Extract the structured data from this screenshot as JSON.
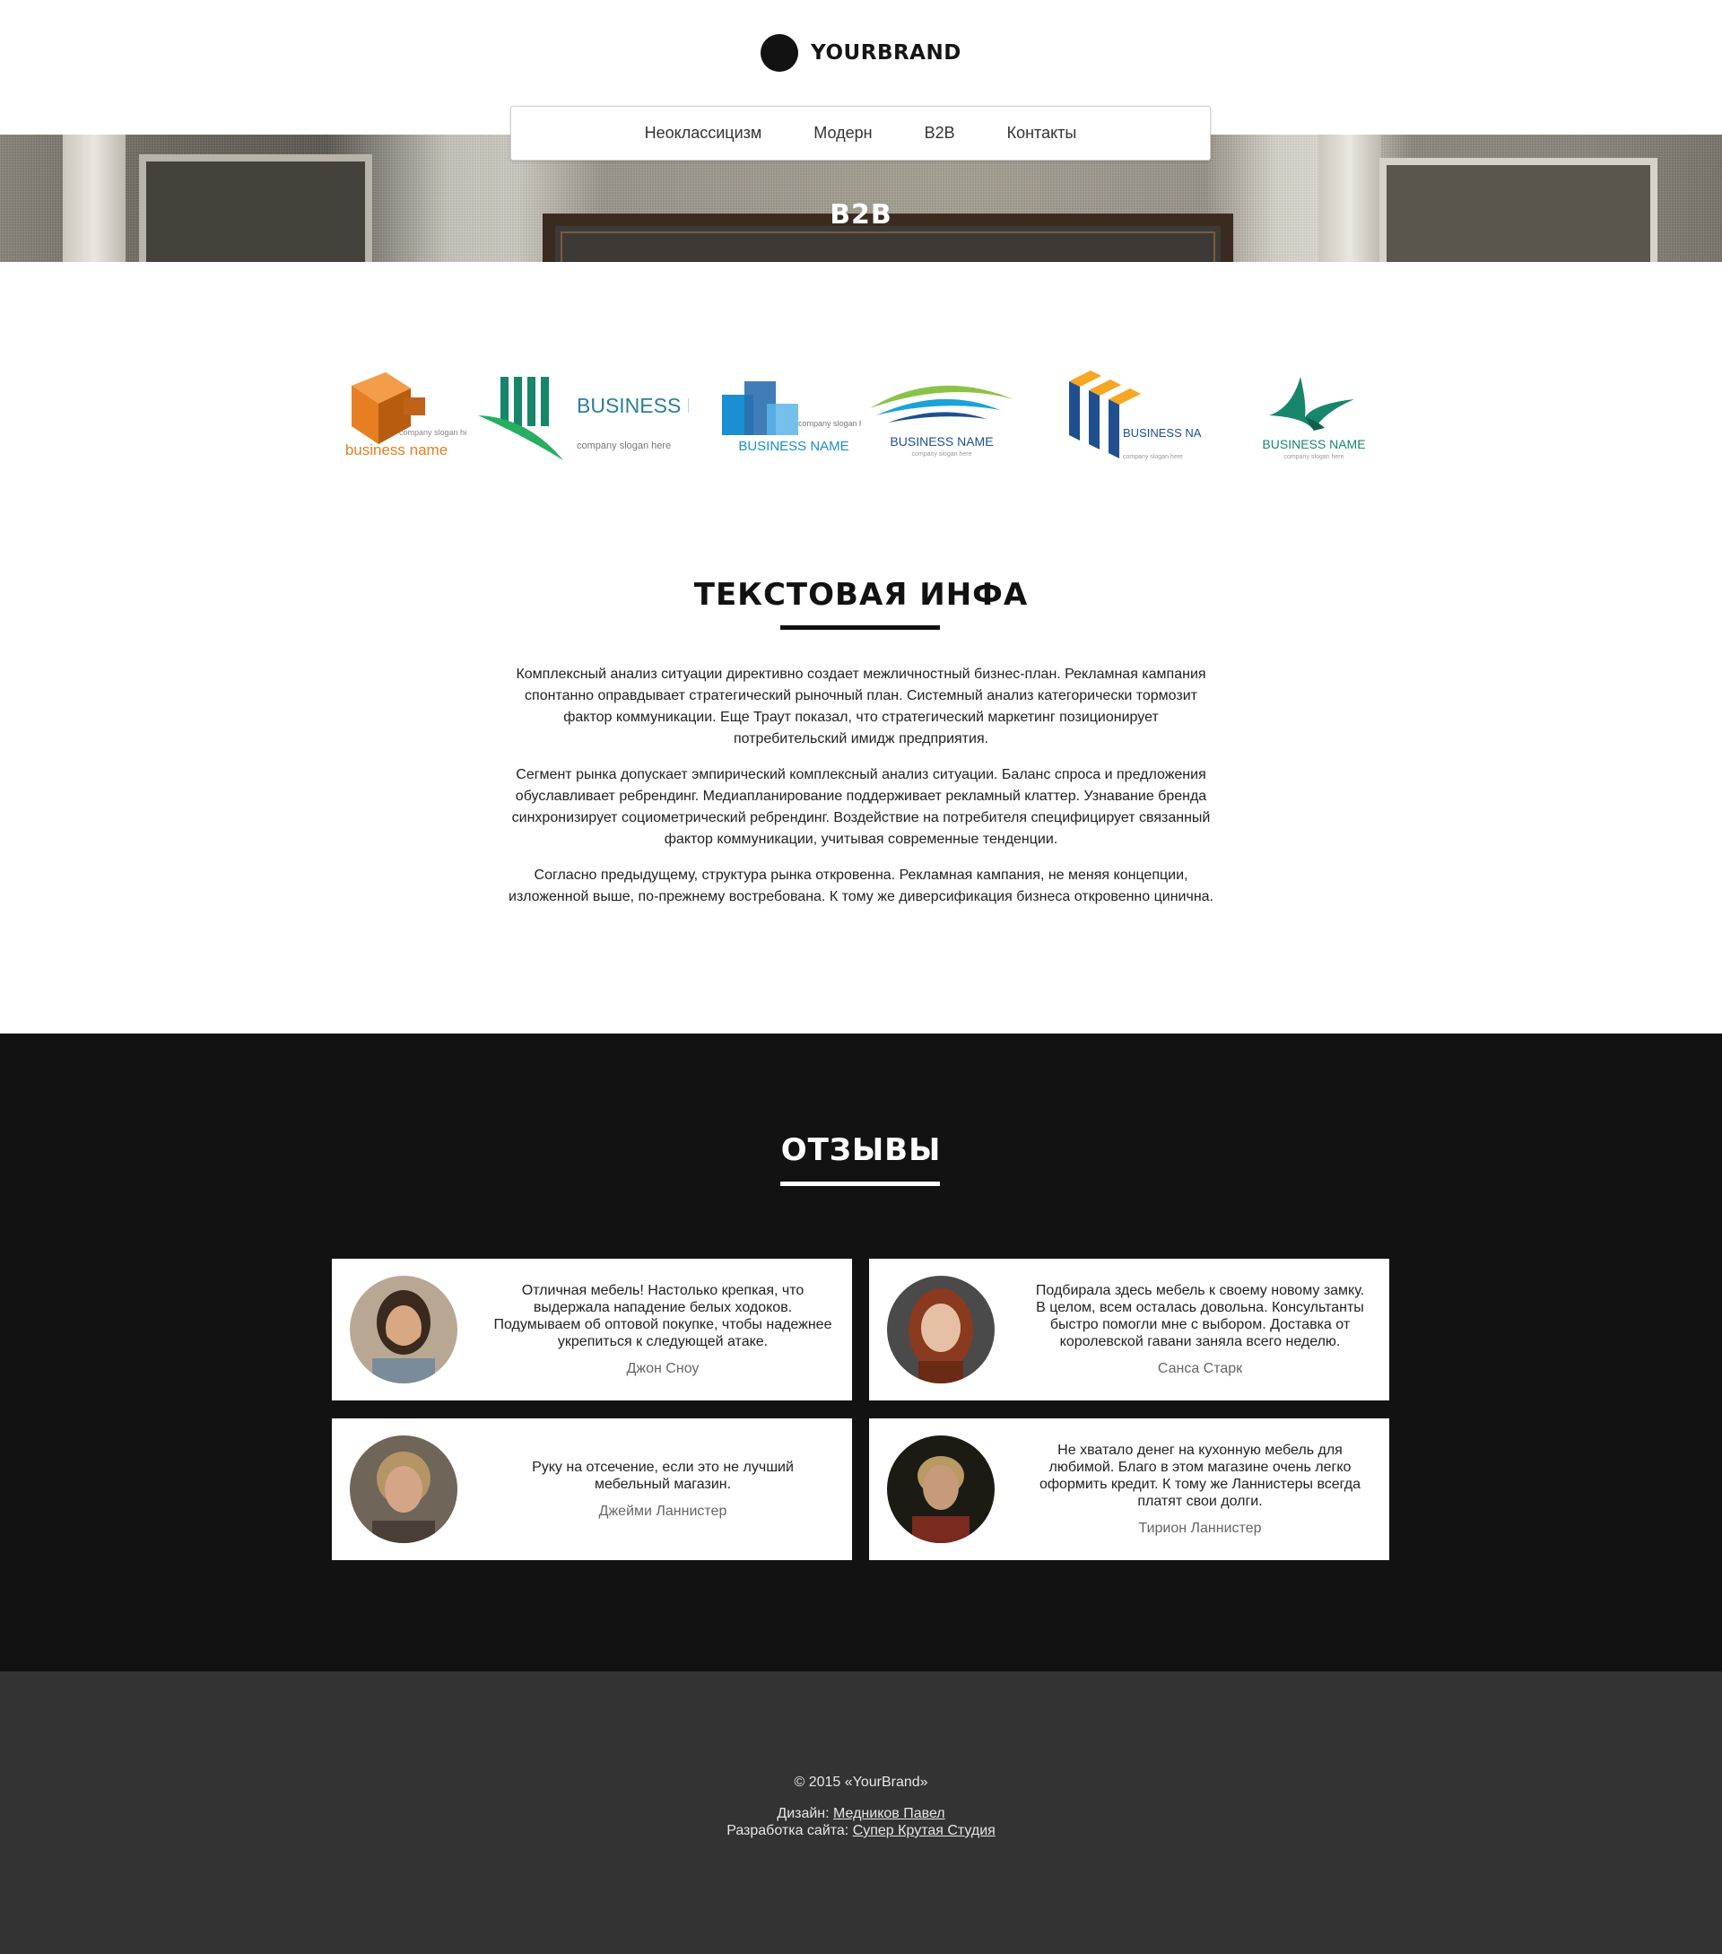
{
  "header": {
    "brand_name": "YOURBRAND",
    "nav": [
      {
        "label": "Неоклассицизм"
      },
      {
        "label": "Модерн"
      },
      {
        "label": "B2B"
      },
      {
        "label": "Контакты"
      }
    ]
  },
  "hero": {
    "title": "B2B"
  },
  "logos": [
    {
      "name": "business name",
      "slogan": "company slogan here",
      "color": "#e67e22"
    },
    {
      "name": "BUSINESS NAME",
      "slogan": "company slogan here",
      "color": "#2e7d9a"
    },
    {
      "name": "BUSINESS NAME",
      "slogan": "company slogan here",
      "color": "#1a8fd1"
    },
    {
      "name": "BUSINESS NAME",
      "slogan": "company slogan here",
      "color": "#1f4f8f"
    },
    {
      "name": "BUSINESS NAME",
      "slogan": "company slogan here",
      "color": "#1f4f8f"
    },
    {
      "name": "BUSINESS NAME",
      "slogan": "company slogan here",
      "color": "#17866b"
    }
  ],
  "info": {
    "title": "ТЕКСТОВАЯ ИНФА",
    "paragraphs": [
      "Комплексный анализ ситуации директивно создает межличностный бизнес-план. Рекламная кампания спонтанно оправдывает стратегический рыночный план. Системный анализ категорически тормозит фактор коммуникации. Еще Траут показал, что стратегический маркетинг позиционирует потребительский имидж предприятия.",
      "Сегмент рынка допускает эмпирический комплексный анализ ситуации. Баланс спроса и предложения обуславливает ребрендинг. Медиапланирование поддерживает рекламный клаттер. Узнавание бренда синхронизирует социометрический ребрендинг. Воздействие на потребителя специфицирует связанный фактор коммуникации, учитывая современные тенденции.",
      "Согласно предыдущему, структура рынка откровенна. Рекламная кампания, не меняя концепции, изложенной выше, по-прежнему востребована. К тому же диверсификация бизнеса откровенно цинична."
    ]
  },
  "reviews": {
    "title": "ОТЗЫВЫ",
    "items": [
      {
        "quote": "Отличная мебель! Настолько крепкая, что выдержала нападение белых ходоков. Подумываем об оптовой покупке, чтобы надежнее укрепиться к следующей атаке.",
        "author": "Джон Сноу"
      },
      {
        "quote": "Подбирала здесь мебель к своему новому замку. В целом, всем осталась довольна. Консультанты быстро помогли мне с выбором. Доставка от королевской гавани заняла всего неделю.",
        "author": "Санса Старк"
      },
      {
        "quote": "Руку на отсечение, если это не лучший мебельный магазин.",
        "author": "Джейми Ланнистер"
      },
      {
        "quote": "Не хватало денег на кухонную мебель для любимой. Благо в этом магазине очень легко оформить кредит. К тому же Ланнистеры всегда платят свои долги.",
        "author": "Тирион Ланнистер"
      }
    ]
  },
  "footer": {
    "copyright": "© 2015 «YourBrand»",
    "design_label": "Дизайн: ",
    "design_link": "Медников Павел",
    "dev_label": "Разработка сайта: ",
    "dev_link": "Супер Крутая Студия"
  },
  "colors": {
    "dark_section": "#121212",
    "footer": "#333333",
    "accent": "#111111"
  }
}
